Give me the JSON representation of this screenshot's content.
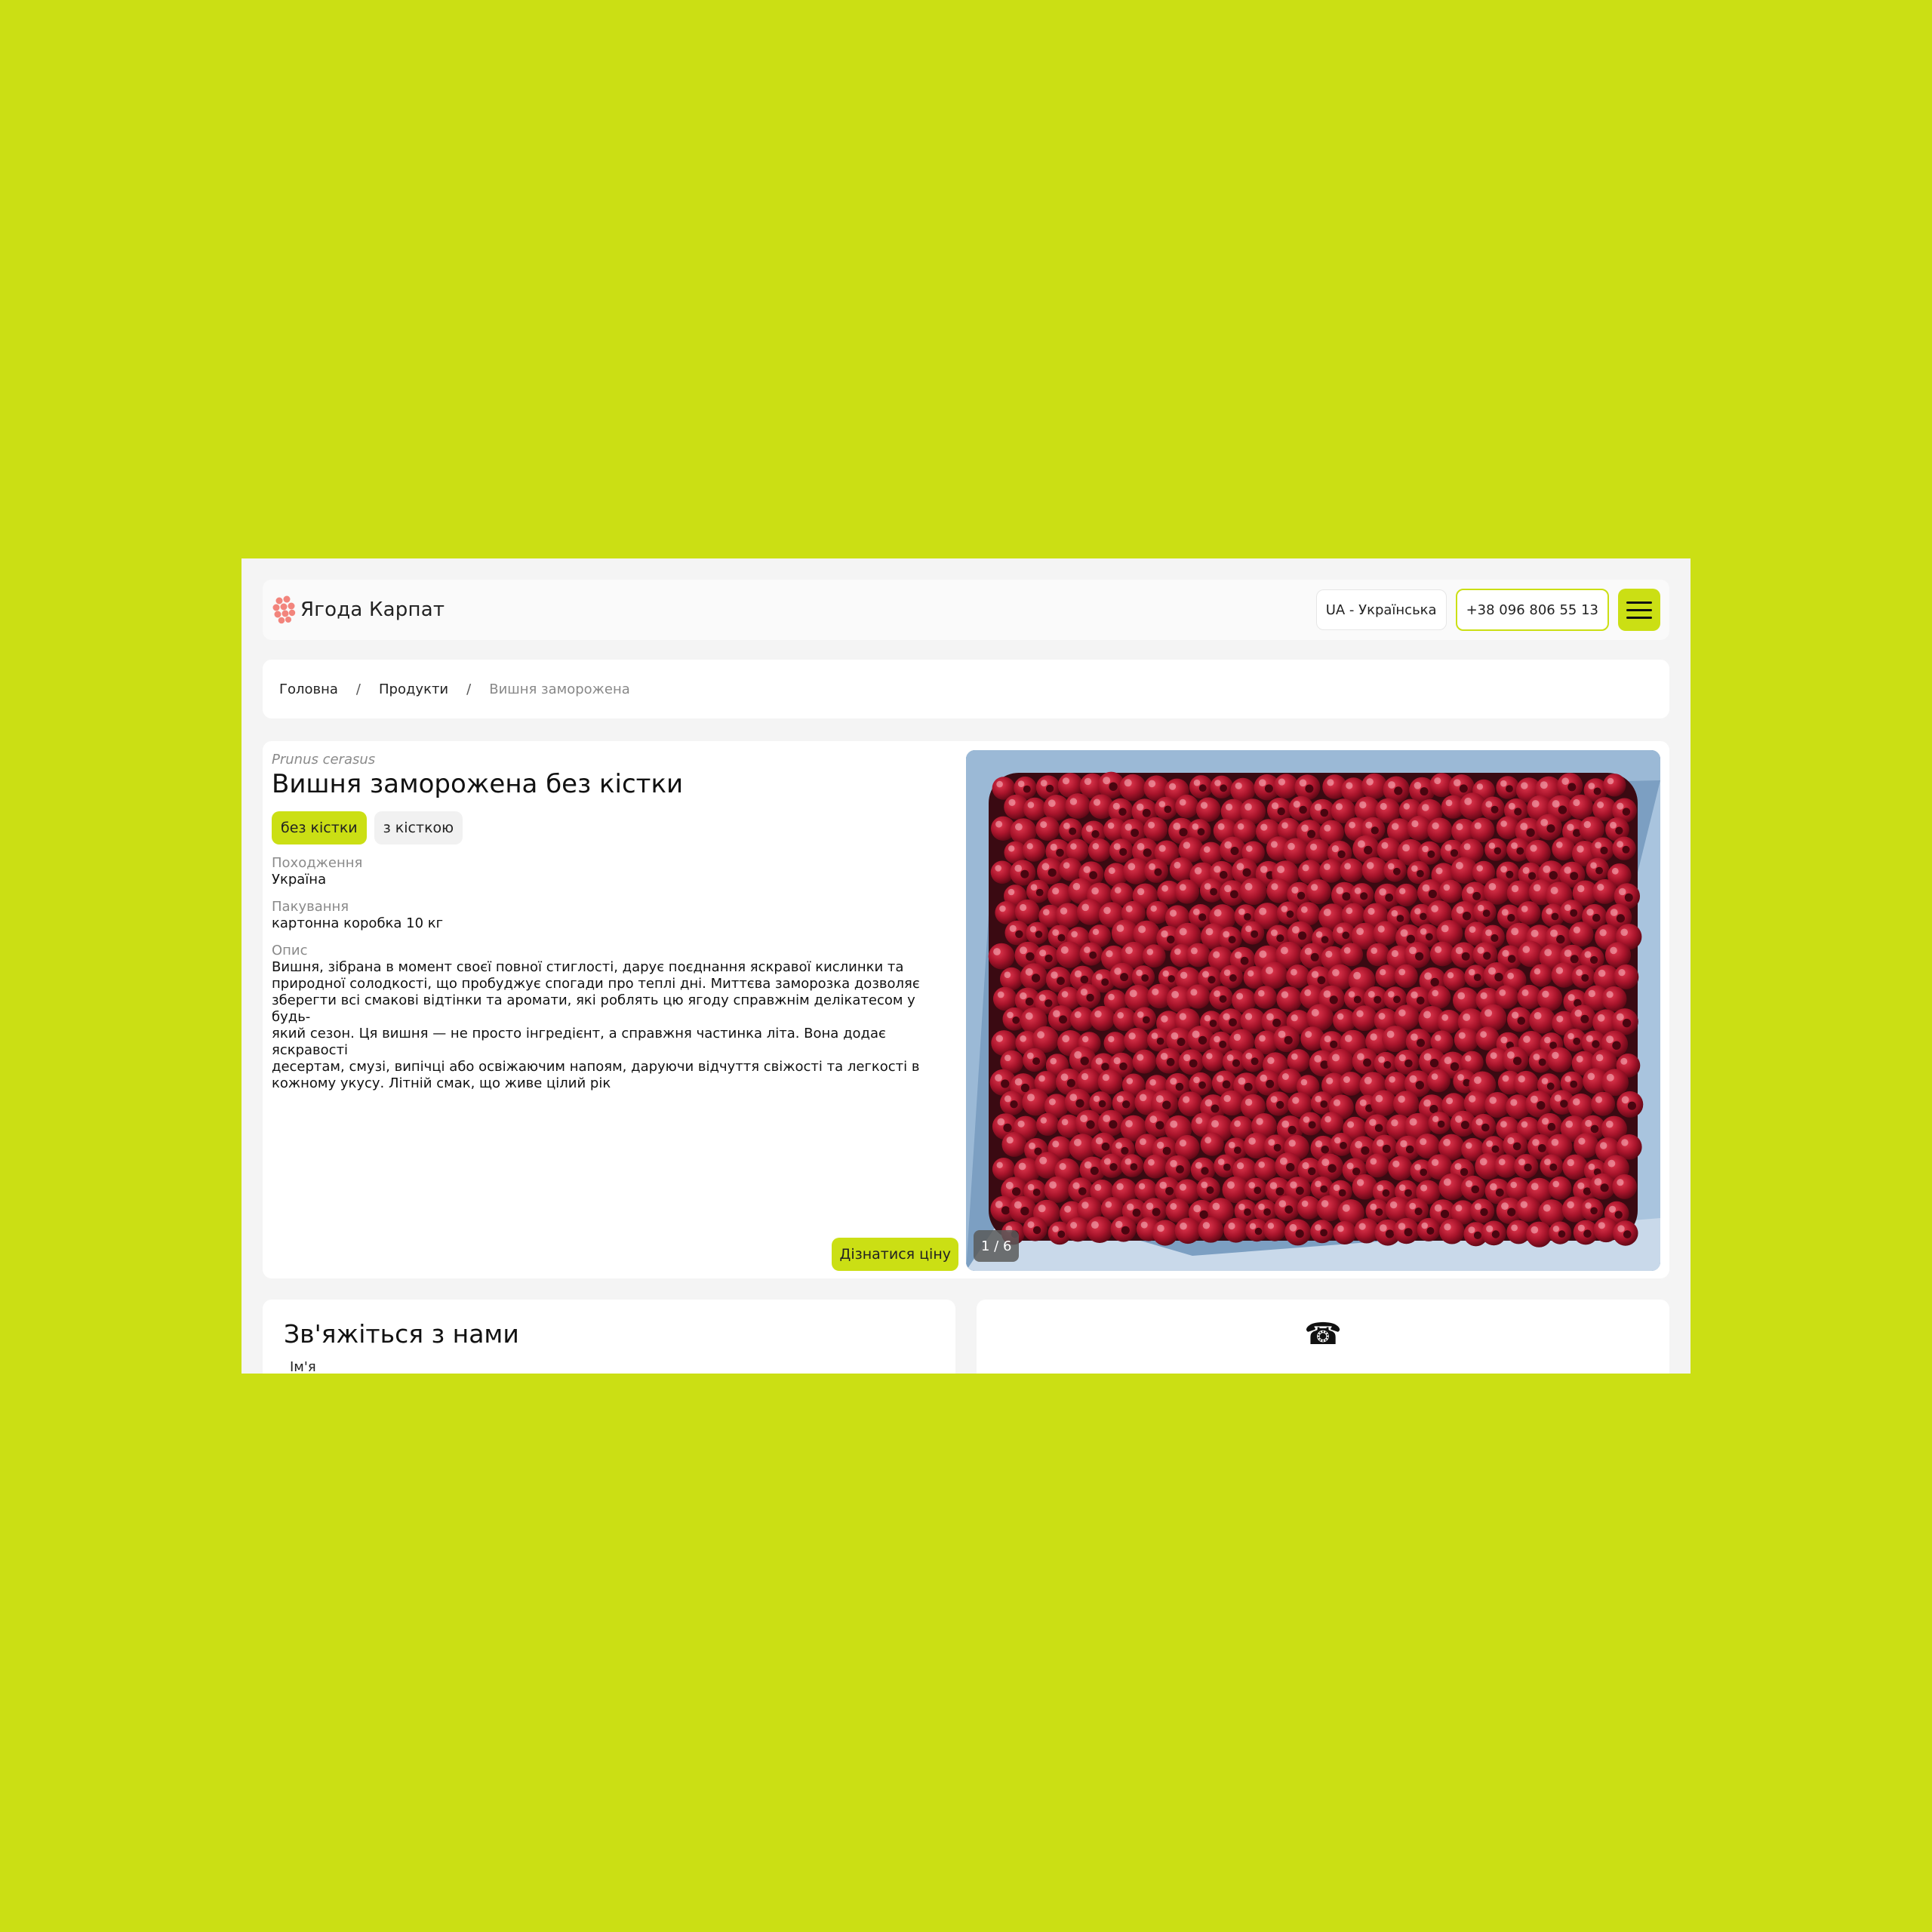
{
  "header": {
    "logo_text": "Ягода Карпат",
    "language": "UA - Українська",
    "phone": "+38 096 806 55 13",
    "menu_icon": "hamburger-icon",
    "accent_color": "#cbdf14",
    "logo_color": "#f2847c"
  },
  "breadcrumb": {
    "items": [
      "Головна",
      "Продукти"
    ],
    "separator": "/",
    "current": "Вишня заморожена"
  },
  "product": {
    "latin_name": "Prunus cerasus",
    "title": "Вишня заморожена без кістки",
    "variants": [
      {
        "label": "без кістки",
        "active": true
      },
      {
        "label": "з кісткою",
        "active": false
      }
    ],
    "origin_label": "Походження",
    "origin_value": "Україна",
    "packaging_label": "Пакування",
    "packaging_value": "картонна коробка 10 кг",
    "description_label": "Опис",
    "description_lines": [
      "Вишня, зібрана в момент своєї повної стиглості, дарує поєднання яскравої кислинки та",
      "природної солодкості, що пробуджує спогади про теплі дні. Миттєва заморозка дозволяє",
      "зберегти всі смакові відтінки та аромати, які роблять цю ягоду справжнім делікатесом у будь-",
      "який сезон. Ця вишня — не просто інгредієнт, а справжня частинка літа. Вона додає яскравості",
      "десертам, смузі, випічці або освіжаючим напоям, даруючи відчуття свіжості та легкості в",
      "кожному укусу. Літній смак, що живе цілий рік"
    ],
    "price_button": "Дізнатися ціну",
    "gallery_counter": "1 / 6"
  },
  "contact": {
    "title": "Зв'яжіться з нами",
    "name_label": "Ім'я",
    "phone_icon": "telephone-icon",
    "phone_glyph": "☎"
  }
}
